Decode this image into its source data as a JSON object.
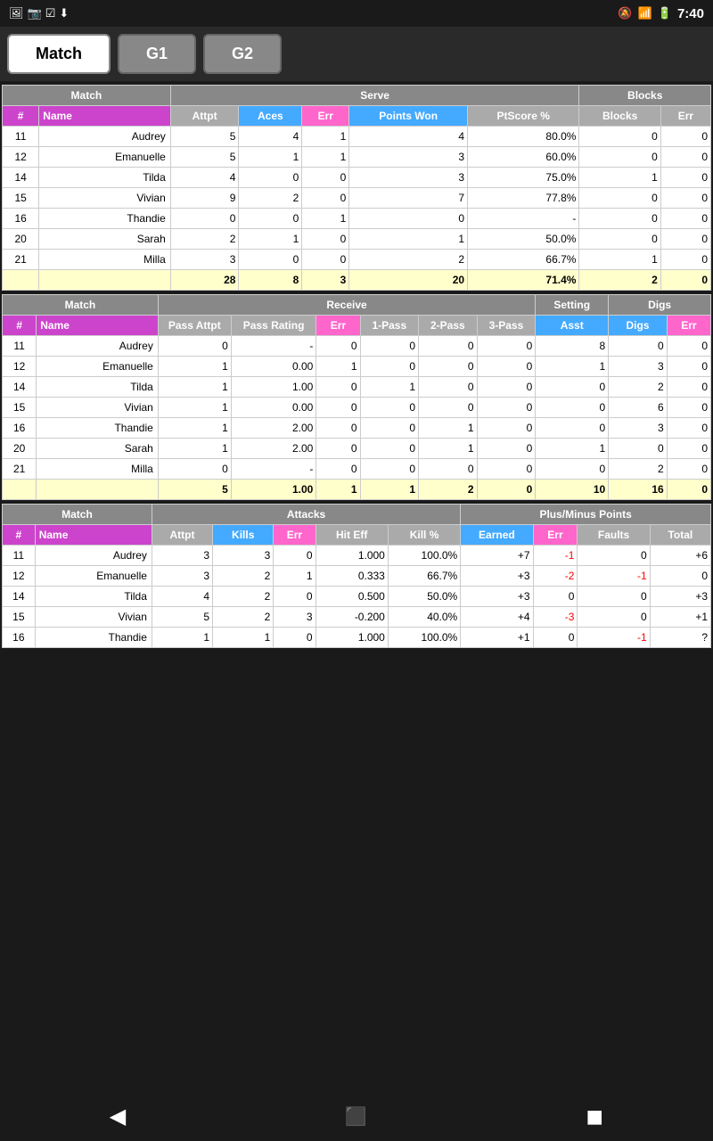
{
  "statusBar": {
    "time": "7:40",
    "icons": "🔔 📶 🔋"
  },
  "tabs": [
    {
      "id": "match",
      "label": "Match",
      "active": true
    },
    {
      "id": "g1",
      "label": "G1",
      "active": false
    },
    {
      "id": "g2",
      "label": "G2",
      "active": false
    }
  ],
  "serveTable": {
    "sectionLabel": "Match",
    "serveLabel": "Serve",
    "blocksLabel": "Blocks",
    "headers": [
      "#",
      "Name",
      "Attpt",
      "Aces",
      "Err",
      "Points Won",
      "PtScore %",
      "Blocks",
      "Err"
    ],
    "rows": [
      {
        "num": "11",
        "name": "Audrey",
        "attpt": "5",
        "aces": "4",
        "err": "1",
        "pointsWon": "4",
        "ptScore": "80.0%",
        "blocks": "0",
        "bErr": "0"
      },
      {
        "num": "12",
        "name": "Emanuelle",
        "attpt": "5",
        "aces": "1",
        "err": "1",
        "pointsWon": "3",
        "ptScore": "60.0%",
        "blocks": "0",
        "bErr": "0"
      },
      {
        "num": "14",
        "name": "Tilda",
        "attpt": "4",
        "aces": "0",
        "err": "0",
        "pointsWon": "3",
        "ptScore": "75.0%",
        "blocks": "1",
        "bErr": "0"
      },
      {
        "num": "15",
        "name": "Vivian",
        "attpt": "9",
        "aces": "2",
        "err": "0",
        "pointsWon": "7",
        "ptScore": "77.8%",
        "blocks": "0",
        "bErr": "0"
      },
      {
        "num": "16",
        "name": "Thandie",
        "attpt": "0",
        "aces": "0",
        "err": "1",
        "pointsWon": "0",
        "ptScore": "-",
        "blocks": "0",
        "bErr": "0"
      },
      {
        "num": "20",
        "name": "Sarah",
        "attpt": "2",
        "aces": "1",
        "err": "0",
        "pointsWon": "1",
        "ptScore": "50.0%",
        "blocks": "0",
        "bErr": "0"
      },
      {
        "num": "21",
        "name": "Milla",
        "attpt": "3",
        "aces": "0",
        "err": "0",
        "pointsWon": "2",
        "ptScore": "66.7%",
        "blocks": "1",
        "bErr": "0"
      }
    ],
    "totals": {
      "attpt": "28",
      "aces": "8",
      "err": "3",
      "pointsWon": "20",
      "ptScore": "71.4%",
      "blocks": "2",
      "bErr": "0"
    }
  },
  "receiveTable": {
    "sectionLabel": "Match",
    "receiveLabel": "Receive",
    "settingLabel": "Setting",
    "digsLabel": "Digs",
    "headers": [
      "#",
      "Name",
      "Pass Attpt",
      "Pass Rating",
      "Err",
      "1-Pass",
      "2-Pass",
      "3-Pass",
      "Asst",
      "Digs",
      "Err"
    ],
    "rows": [
      {
        "num": "11",
        "name": "Audrey",
        "passAttpt": "0",
        "passRating": "-",
        "err": "0",
        "p1": "0",
        "p2": "0",
        "p3": "0",
        "asst": "8",
        "digs": "0",
        "dErr": "0"
      },
      {
        "num": "12",
        "name": "Emanuelle",
        "passAttpt": "1",
        "passRating": "0.00",
        "err": "1",
        "p1": "0",
        "p2": "0",
        "p3": "0",
        "asst": "1",
        "digs": "3",
        "dErr": "0"
      },
      {
        "num": "14",
        "name": "Tilda",
        "passAttpt": "1",
        "passRating": "1.00",
        "err": "0",
        "p1": "1",
        "p2": "0",
        "p3": "0",
        "asst": "0",
        "digs": "2",
        "dErr": "0"
      },
      {
        "num": "15",
        "name": "Vivian",
        "passAttpt": "1",
        "passRating": "0.00",
        "err": "0",
        "p1": "0",
        "p2": "0",
        "p3": "0",
        "asst": "0",
        "digs": "6",
        "dErr": "0"
      },
      {
        "num": "16",
        "name": "Thandie",
        "passAttpt": "1",
        "passRating": "2.00",
        "err": "0",
        "p1": "0",
        "p2": "1",
        "p3": "0",
        "asst": "0",
        "digs": "3",
        "dErr": "0"
      },
      {
        "num": "20",
        "name": "Sarah",
        "passAttpt": "1",
        "passRating": "2.00",
        "err": "0",
        "p1": "0",
        "p2": "1",
        "p3": "0",
        "asst": "1",
        "digs": "0",
        "dErr": "0"
      },
      {
        "num": "21",
        "name": "Milla",
        "passAttpt": "0",
        "passRating": "-",
        "err": "0",
        "p1": "0",
        "p2": "0",
        "p3": "0",
        "asst": "0",
        "digs": "2",
        "dErr": "0"
      }
    ],
    "totals": {
      "passAttpt": "5",
      "passRating": "1.00",
      "err": "1",
      "p1": "1",
      "p2": "2",
      "p3": "0",
      "asst": "10",
      "digs": "16",
      "dErr": "0"
    }
  },
  "attacksTable": {
    "sectionLabel": "Match",
    "attacksLabel": "Attacks",
    "plusMinusLabel": "Plus/Minus Points",
    "headers": [
      "#",
      "Name",
      "Attpt",
      "Kills",
      "Err",
      "Hit Eff",
      "Kill %",
      "Earned",
      "Err",
      "Faults",
      "Total"
    ],
    "rows": [
      {
        "num": "11",
        "name": "Audrey",
        "attpt": "3",
        "kills": "3",
        "err": "0",
        "hitEff": "1.000",
        "killPct": "100.0%",
        "earned": "+7",
        "pmErr": "-1",
        "faults": "0",
        "total": "+6",
        "pmErrRed": true
      },
      {
        "num": "12",
        "name": "Emanuelle",
        "attpt": "3",
        "kills": "2",
        "err": "1",
        "hitEff": "0.333",
        "killPct": "66.7%",
        "earned": "+3",
        "pmErr": "-2",
        "faults": "-1",
        "total": "0",
        "pmErrRed": true,
        "faultsRed": true
      },
      {
        "num": "14",
        "name": "Tilda",
        "attpt": "4",
        "kills": "2",
        "err": "0",
        "hitEff": "0.500",
        "killPct": "50.0%",
        "earned": "+3",
        "pmErr": "0",
        "faults": "0",
        "total": "+3"
      },
      {
        "num": "15",
        "name": "Vivian",
        "attpt": "5",
        "kills": "2",
        "err": "3",
        "hitEff": "-0.200",
        "killPct": "40.0%",
        "earned": "+4",
        "pmErr": "-3",
        "faults": "0",
        "total": "+1",
        "pmErrRed": true
      },
      {
        "num": "16",
        "name": "Thandie",
        "attpt": "1",
        "kills": "1",
        "err": "0",
        "hitEff": "1.000",
        "killPct": "100.0%",
        "earned": "+1",
        "pmErr": "0",
        "faults": "-1",
        "total": "?",
        "faultsRed": true
      }
    ]
  },
  "nav": {
    "back": "◀",
    "home": "⬛",
    "recents": "◼"
  }
}
